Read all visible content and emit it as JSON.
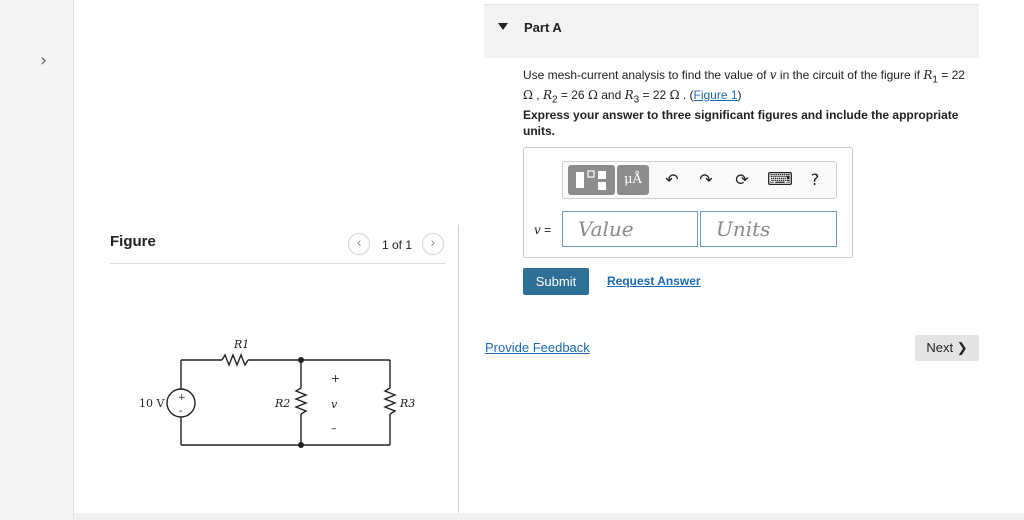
{
  "rail": {
    "expand_icon": "chevron-right-icon"
  },
  "figure": {
    "title": "Figure",
    "counter": "1 of 1",
    "circuit": {
      "source_label": "10 V",
      "source_plus": "+",
      "source_minus": "-",
      "r1": "R1",
      "r2": "R2",
      "r3": "R3",
      "v_label": "v",
      "v_plus": "+",
      "v_minus": "–"
    }
  },
  "part": {
    "title": "Part A"
  },
  "question": {
    "intro": "Use mesh-current analysis to find the value of ",
    "var_v": "v",
    "mid": " in the circuit of the figure if ",
    "r1_sym": "R",
    "r1_sub": "1",
    "r1_eq": " = 22 ",
    "ohm": "Ω",
    "sep1": " , ",
    "r2_sym": "R",
    "r2_sub": "2",
    "r2_eq": " = 26 ",
    "sep2": " and ",
    "r3_sym": "R",
    "r3_sub": "3",
    "r3_eq": " = 22 ",
    "sep3": " . (",
    "figure_link": "Figure 1",
    "close": ")"
  },
  "instructions": "Express your answer to three significant figures and include the appropriate units.",
  "answer": {
    "var_label": "v",
    "eq": " =",
    "value_placeholder": "Value",
    "units_placeholder": "Units",
    "toolbar": {
      "units_label": "μÅ",
      "undo_icon": "↶",
      "redo_icon": "↷",
      "reset_icon": "⟳",
      "keyboard_icon": "⌨",
      "help_icon": "?"
    }
  },
  "actions": {
    "submit": "Submit",
    "request_answer": "Request Answer",
    "provide_feedback": "Provide Feedback",
    "next": "Next ❯"
  }
}
